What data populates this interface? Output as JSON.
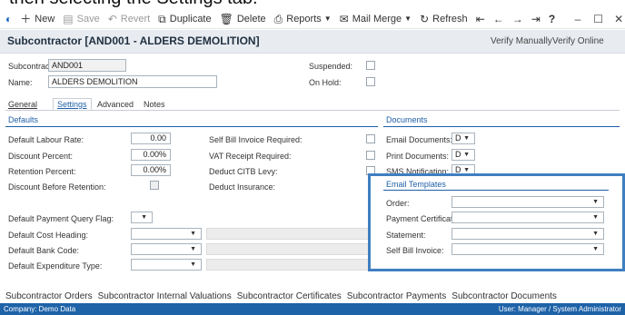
{
  "caption": "then selecting the Settings tab.",
  "toolbar": {
    "new": "New",
    "save": "Save",
    "revert": "Revert",
    "duplicate": "Duplicate",
    "delete": "Delete",
    "reports": "Reports",
    "mail_merge": "Mail Merge",
    "refresh": "Refresh",
    "help": "?",
    "icons": [
      "new-icon",
      "save-icon",
      "revert-icon",
      "duplicate-icon",
      "delete-icon",
      "print-icon",
      "mail-icon",
      "refresh-icon",
      "first-icon",
      "prev-icon",
      "next-icon",
      "last-icon"
    ]
  },
  "title": {
    "text": "Subcontractor [AND001 - ALDERS DEMOLITION]",
    "verify_manually": "Verify Manually",
    "verify_online": "Verify Online"
  },
  "header": {
    "subcontractor_label": "Subcontractor:",
    "subcontractor_value": "AND001",
    "name_label": "Name:",
    "name_value": "ALDERS DEMOLITION",
    "suspended_label": "Suspended:",
    "on_hold_label": "On Hold:"
  },
  "tabs": [
    "General",
    "Settings",
    "Advanced",
    "Notes"
  ],
  "defaults": {
    "heading": "Defaults",
    "labour_rate_label": "Default Labour Rate:",
    "labour_rate": "0.00",
    "discount_percent_label": "Discount Percent:",
    "discount_percent": "0.00%",
    "retention_percent_label": "Retention Percent:",
    "retention_percent": "0.00%",
    "discount_before_retention_label": "Discount Before Retention:",
    "payment_query_flag_label": "Default Payment Query Flag:",
    "cost_heading_label": "Default Cost Heading:",
    "bank_code_label": "Default Bank Code:",
    "expenditure_type_label": "Default Expenditure Type:",
    "self_bill_invoice_label": "Self Bill Invoice Required:",
    "vat_receipt_label": "VAT Receipt Required:",
    "deduct_citb_label": "Deduct CITB Levy:",
    "deduct_insurance_label": "Deduct Insurance:"
  },
  "documents": {
    "heading": "Documents",
    "email_documents_label": "Email Documents:",
    "email_documents": "D",
    "print_documents_label": "Print Documents:",
    "print_documents": "D",
    "sms_notification_label": "SMS Notification:",
    "sms_notification": "D"
  },
  "email_templates": {
    "heading": "Email Templates",
    "order_label": "Order:",
    "payment_certificate_label": "Payment Certificate:",
    "statement_label": "Statement:",
    "self_bill_invoice_label": "Self Bill Invoice:"
  },
  "bottom_links": [
    "Subcontractor Orders",
    "Subcontractor Internal Valuations",
    "Subcontractor Certificates",
    "Subcontractor Payments",
    "Subcontractor Documents"
  ],
  "status": {
    "company": "Company: Demo Data",
    "user": "User: Manager / System Administrator"
  }
}
